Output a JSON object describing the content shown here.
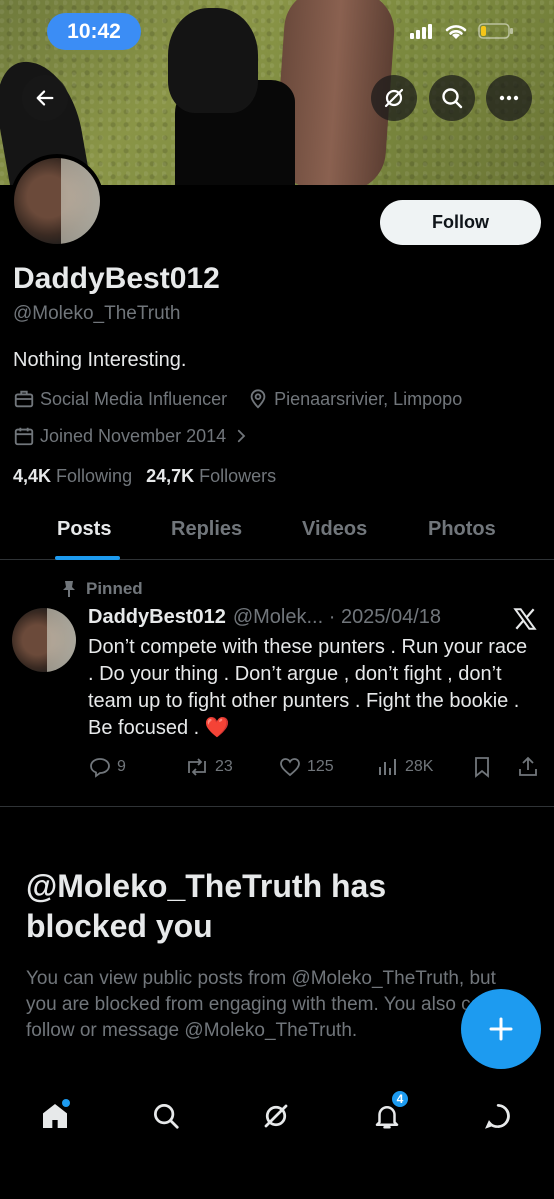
{
  "status_bar": {
    "time": "10:42"
  },
  "profile": {
    "follow_label": "Follow",
    "display_name": "DaddyBest012",
    "handle": "@Moleko_TheTruth",
    "bio": "Nothing Interesting.",
    "category": "Social Media Influencer",
    "location": "Pienaarsrivier, Limpopo",
    "joined": "Joined November 2014",
    "following_count": "4,4K",
    "following_label": "Following",
    "followers_count": "24,7K",
    "followers_label": "Followers"
  },
  "tabs": [
    {
      "label": "Posts",
      "active": true
    },
    {
      "label": "Replies",
      "active": false
    },
    {
      "label": "Videos",
      "active": false
    },
    {
      "label": "Photos",
      "active": false
    }
  ],
  "post": {
    "pinned_label": "Pinned",
    "author": "DaddyBest012",
    "handle_date": "@Molek... · 2025/04/18",
    "text": "Don’t compete with these punters . Run your race . Do your thing . Don’t argue , don’t fight , don’t team up to fight other punters . Fight the bookie . Be focused . ",
    "emoji": "❤️",
    "replies": "9",
    "reposts": "23",
    "likes": "125",
    "views": "28K"
  },
  "blocked": {
    "title": "@Moleko_TheTruth has blocked you",
    "text": "You can view public posts from @Moleko_TheTruth, but you are blocked from engaging with them. You also cannot follow or message @Moleko_TheTruth."
  },
  "nav": {
    "notifications_badge": "4"
  },
  "colors": {
    "accent": "#1d9bf0",
    "muted": "#71767b",
    "text": "#e7e9ea",
    "background": "#000000"
  }
}
